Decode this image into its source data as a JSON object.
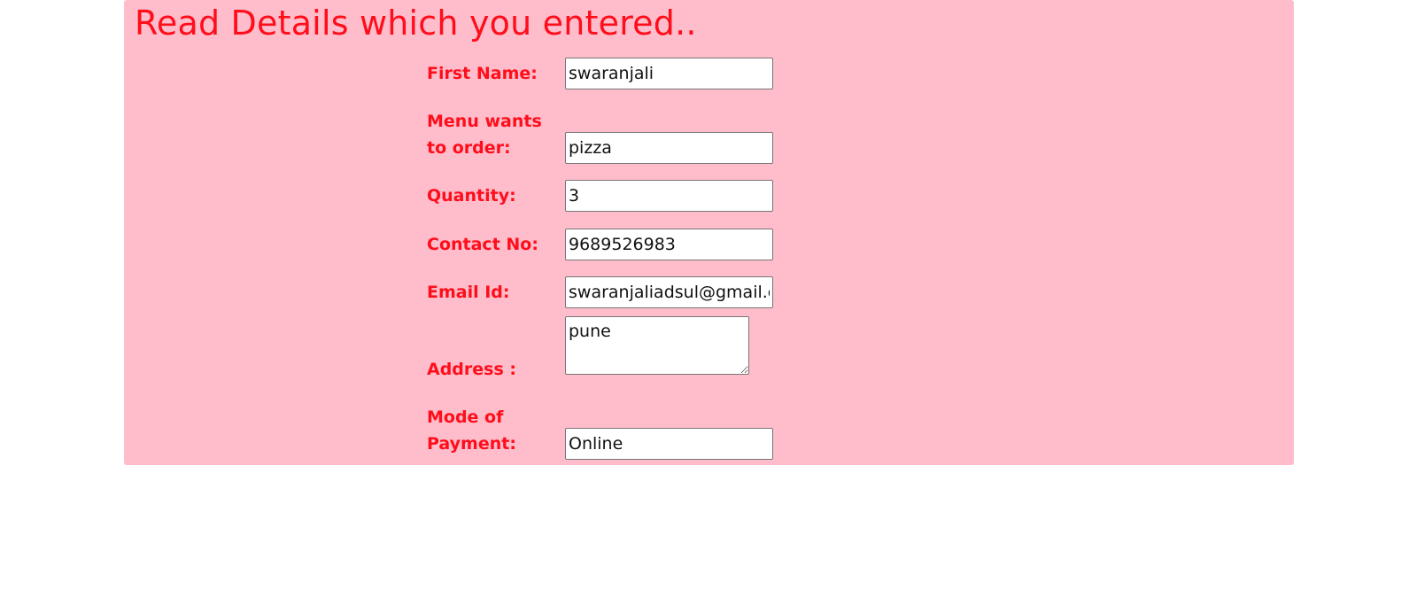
{
  "page": {
    "heading": "Read Details which you entered.."
  },
  "form": {
    "first_name": {
      "label": "First Name:",
      "value": "swaranjali"
    },
    "menu": {
      "label_line1": "Menu wants",
      "label_line2": "to order:",
      "value": "pizza"
    },
    "quantity": {
      "label": "Quantity:",
      "value": "3"
    },
    "contact": {
      "label": "Contact No:",
      "value": "9689526983"
    },
    "email": {
      "label": "Email Id:",
      "value": "swaranjaliadsul@gmail.co"
    },
    "address": {
      "label": "Address :",
      "value": "pune"
    },
    "payment": {
      "label_line1": "Mode of",
      "label_line2": "Payment:",
      "value": "Online"
    }
  },
  "colors": {
    "panel_background": "#ffbcca",
    "text_accent": "#ff0d1a"
  }
}
